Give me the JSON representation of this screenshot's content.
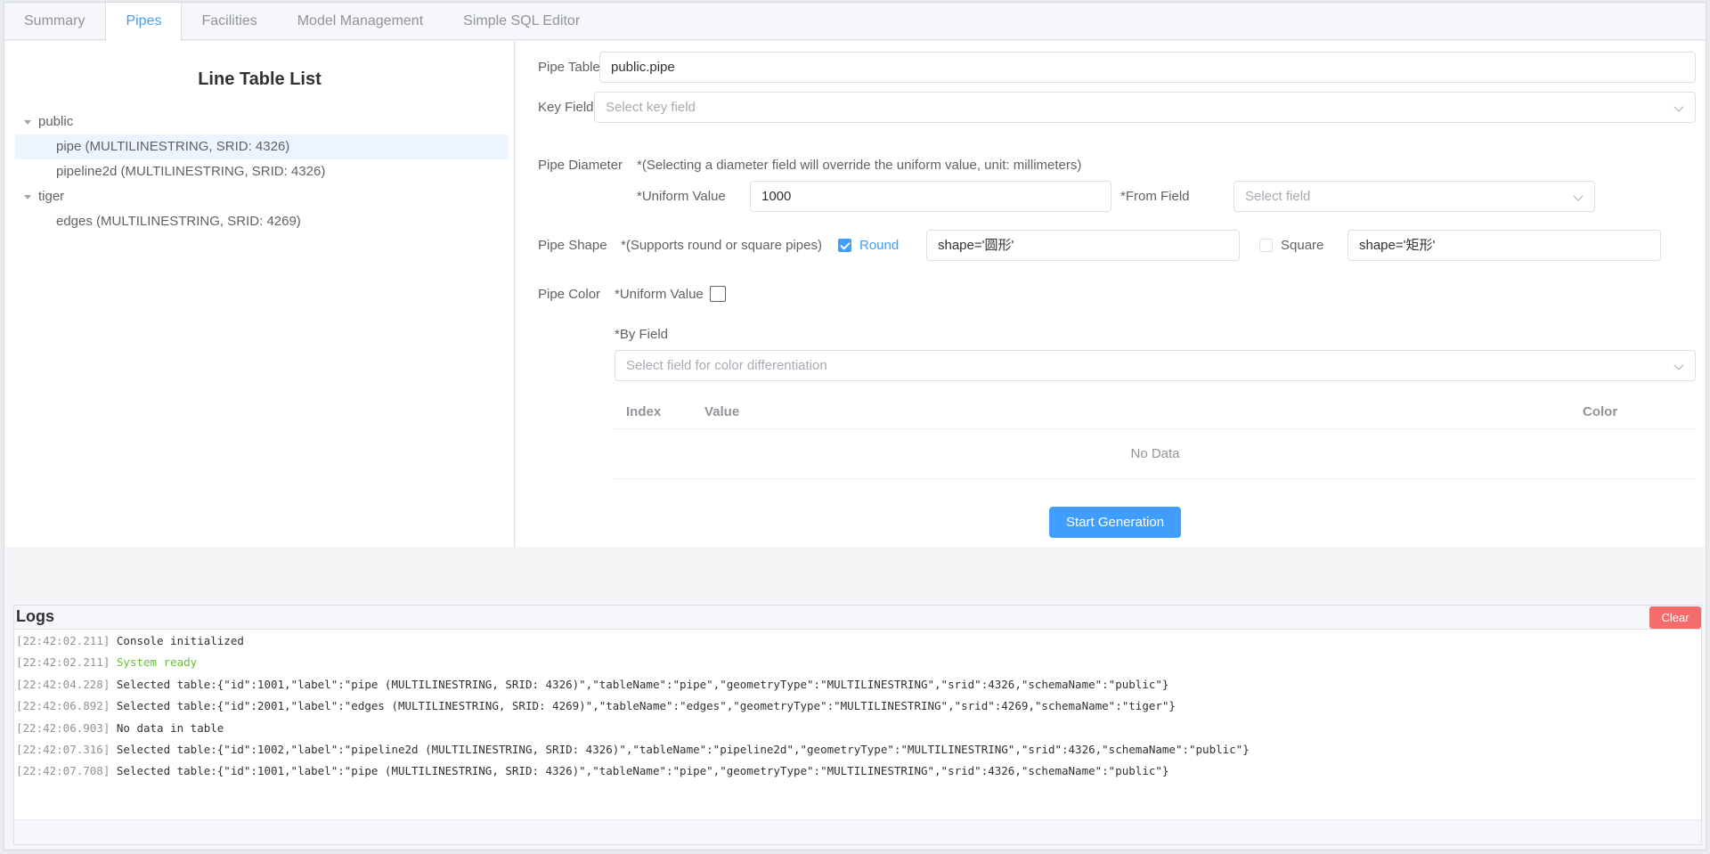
{
  "tabs": [
    "Summary",
    "Pipes",
    "Facilities",
    "Model Management",
    "Simple SQL Editor"
  ],
  "left": {
    "title": "Line Table List",
    "tree": [
      {
        "label": "public",
        "children": [
          "pipe (MULTILINESTRING, SRID: 4326)",
          "pipeline2d (MULTILINESTRING, SRID: 4326)"
        ]
      },
      {
        "label": "tiger",
        "children": [
          "edges (MULTILINESTRING, SRID: 4269)"
        ]
      }
    ]
  },
  "form": {
    "pipe_table": {
      "label": "Pipe Table",
      "value": "public.pipe"
    },
    "key_field": {
      "label": "Key Field",
      "placeholder": "Select key field"
    },
    "diameter": {
      "label": "Pipe Diameter",
      "note": "*(Selecting a diameter field will override the uniform value, unit: millimeters)",
      "uniform_label": "*Uniform Value",
      "uniform_value": "1000",
      "from_field_label": "*From Field",
      "from_field_placeholder": "Select field"
    },
    "shape": {
      "label": "Pipe Shape",
      "note": "*(Supports round or square pipes)",
      "round_label": "Round",
      "round_checked": true,
      "round_value": "shape='圆形'",
      "square_label": "Square",
      "square_checked": false,
      "square_value": "shape='矩形'"
    },
    "color": {
      "label": "Pipe Color",
      "uniform_label": "*Uniform Value",
      "by_field_label": "*By Field",
      "by_field_placeholder": "Select field for color differentiation",
      "table_headers": {
        "index": "Index",
        "value": "Value",
        "color": "Color"
      },
      "empty_text": "No Data"
    },
    "start_button": "Start Generation"
  },
  "logs": {
    "title": "Logs",
    "clear_button": "Clear",
    "lines": [
      {
        "ts": "[22:42:02.211]",
        "msg": "Console initialized",
        "type": "normal"
      },
      {
        "ts": "[22:42:02.211]",
        "msg": "System ready",
        "type": "ok"
      },
      {
        "ts": "[22:42:04.228]",
        "msg": "Selected table:{\"id\":1001,\"label\":\"pipe (MULTILINESTRING, SRID: 4326)\",\"tableName\":\"pipe\",\"geometryType\":\"MULTILINESTRING\",\"srid\":4326,\"schemaName\":\"public\"}",
        "type": "normal"
      },
      {
        "ts": "[22:42:06.892]",
        "msg": "Selected table:{\"id\":2001,\"label\":\"edges (MULTILINESTRING, SRID: 4269)\",\"tableName\":\"edges\",\"geometryType\":\"MULTILINESTRING\",\"srid\":4269,\"schemaName\":\"tiger\"}",
        "type": "normal"
      },
      {
        "ts": "[22:42:06.903]",
        "msg": "No data in table",
        "type": "normal"
      },
      {
        "ts": "[22:42:07.316]",
        "msg": "Selected table:{\"id\":1002,\"label\":\"pipeline2d (MULTILINESTRING, SRID: 4326)\",\"tableName\":\"pipeline2d\",\"geometryType\":\"MULTILINESTRING\",\"srid\":4326,\"schemaName\":\"public\"}",
        "type": "normal"
      },
      {
        "ts": "[22:42:07.708]",
        "msg": "Selected table:{\"id\":1001,\"label\":\"pipe (MULTILINESTRING, SRID: 4326)\",\"tableName\":\"pipe\",\"geometryType\":\"MULTILINESTRING\",\"srid\":4326,\"schemaName\":\"public\"}",
        "type": "normal"
      }
    ]
  },
  "colors": {
    "accent": "#409eff",
    "danger": "#f56c6c",
    "success": "#67c23a"
  }
}
